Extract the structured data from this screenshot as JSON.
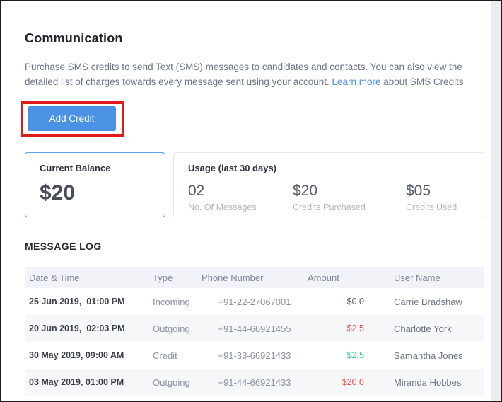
{
  "page": {
    "title": "Communication",
    "description_before_link": "Purchase SMS credits to send Text (SMS) messages to candidates and contacts. You can also view the detailed list of charges towards every message sent using your account. ",
    "learn_more_link": "Learn more",
    "description_after_link": " about SMS Credits"
  },
  "actions": {
    "add_credit_label": "Add Credit"
  },
  "annotation": {
    "type": "red-highlight-rectangle",
    "target": "Add Credit button",
    "color": "#e01b1b"
  },
  "balance_card": {
    "title": "Current Balance",
    "value": "$20"
  },
  "usage_card": {
    "title": "Usage (last 30 days)",
    "stats": [
      {
        "value": "02",
        "label": "No. Of Messages"
      },
      {
        "value": "$20",
        "label": "Credits Purchased"
      },
      {
        "value": "$05",
        "label": "Credits Used"
      }
    ]
  },
  "message_log": {
    "title": "MESSAGE LOG",
    "columns": [
      "Date & Time",
      "Type",
      "Phone Number",
      "Amount",
      "User Name"
    ],
    "rows": [
      {
        "date": "25 Jun 2019,  01:00 PM",
        "type": "Incoming",
        "phone": "+91-22-27067001",
        "amount": "$0.0",
        "amount_color": "neutral",
        "user": "Carrie Bradshaw"
      },
      {
        "date": "20 Jun 2019,  02:03 PM",
        "type": "Outgoing",
        "phone": "+91-44-66921455",
        "amount": "$2.5",
        "amount_color": "negative",
        "user": "Charlotte York"
      },
      {
        "date": "30 May 2019, 09:00 AM",
        "type": "Credit",
        "phone": "+91-33-66921433",
        "amount": "$2.5",
        "amount_color": "positive",
        "user": "Samantha Jones"
      },
      {
        "date": "03 May 2019, 01:00 PM",
        "type": "Outgoing",
        "phone": "+91-44-66921433",
        "amount": "$20.0",
        "amount_color": "negative",
        "user": "Miranda Hobbes"
      }
    ]
  },
  "colors": {
    "accent_blue": "#4b92e5",
    "link_blue": "#4a90e2",
    "annotation_red": "#e01b1b",
    "positive_green": "#2fc98c",
    "negative_red": "#ee4c4c",
    "balance_card_border": "#5f9ef0"
  }
}
